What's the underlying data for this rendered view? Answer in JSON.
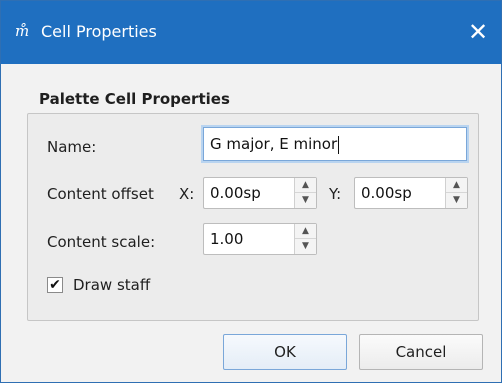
{
  "window": {
    "title": "Cell Properties",
    "close_glyph": "✕",
    "app_icon_glyph": "m̊"
  },
  "group": {
    "title": "Palette Cell Properties"
  },
  "fields": {
    "name_label": "Name:",
    "name_value": "G major, E minor",
    "offset_label": "Content offset",
    "x_label": "X:",
    "x_value": "0.00sp",
    "y_label": "Y:",
    "y_value": "0.00sp",
    "scale_label": "Content scale:",
    "scale_value": "1.00",
    "draw_staff_label": "Draw staff",
    "draw_staff_checked": true,
    "check_glyph": "✔"
  },
  "buttons": {
    "ok": "OK",
    "cancel": "Cancel"
  },
  "colors": {
    "titlebar": "#1f6fc0",
    "focus_border": "#7aa7d9"
  }
}
